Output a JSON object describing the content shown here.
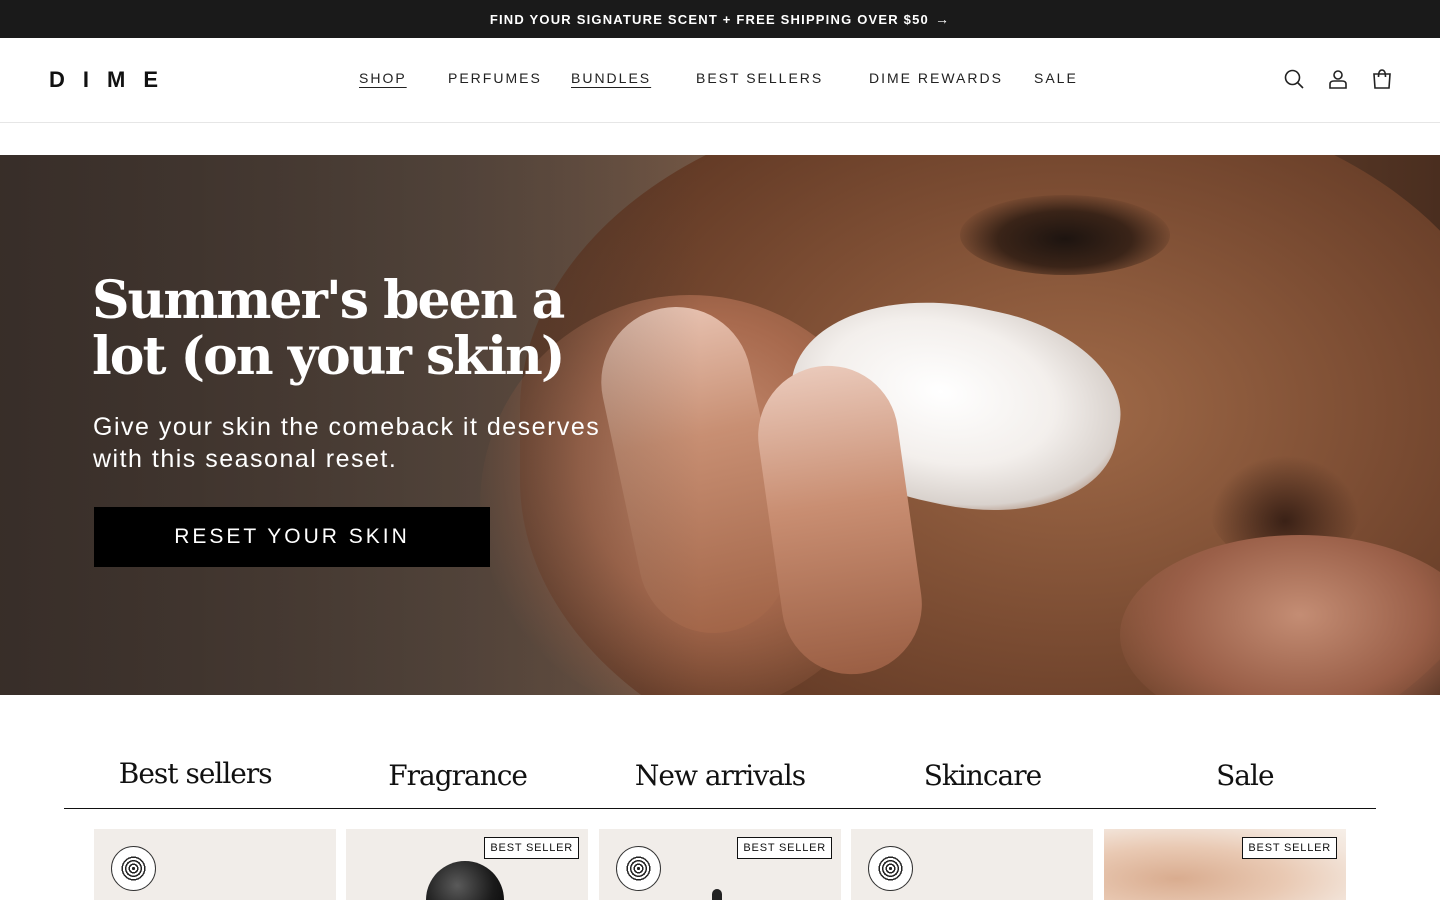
{
  "announcement": {
    "text": "FIND YOUR SIGNATURE SCENT + FREE SHIPPING OVER $50",
    "arrow_icon": "arrow-right-icon"
  },
  "header": {
    "logo": "DIME",
    "nav": [
      {
        "label": "SHOP"
      },
      {
        "label": "PERFUMES"
      },
      {
        "label": "BUNDLES"
      },
      {
        "label": "BEST SELLERS"
      },
      {
        "label": "DIME REWARDS"
      },
      {
        "label": "SALE"
      }
    ],
    "icons": [
      "search-icon",
      "account-icon",
      "cart-icon"
    ]
  },
  "hero": {
    "title": "Summer's been a lot (on your skin)",
    "subtitle": "Give your skin the comeback it deserves with this seasonal reset.",
    "cta": "RESET YOUR SKIN"
  },
  "categories": {
    "tabs": [
      {
        "label": "Best sellers"
      },
      {
        "label": "Fragrance"
      },
      {
        "label": "New arrivals"
      },
      {
        "label": "Skincare"
      },
      {
        "label": "Sale"
      }
    ],
    "active": "Best sellers"
  },
  "products": [
    {
      "badge": "",
      "ewg_verified": true
    },
    {
      "badge": "BEST SELLER",
      "ewg_verified": false
    },
    {
      "badge": "BEST SELLER",
      "ewg_verified": true
    },
    {
      "badge": "",
      "ewg_verified": true
    },
    {
      "badge": "BEST SELLER",
      "ewg_verified": false
    }
  ],
  "colors": {
    "announcement_bg": "#1a1a1a",
    "cta_bg": "#000000",
    "card_bg": "#f1ede9"
  }
}
